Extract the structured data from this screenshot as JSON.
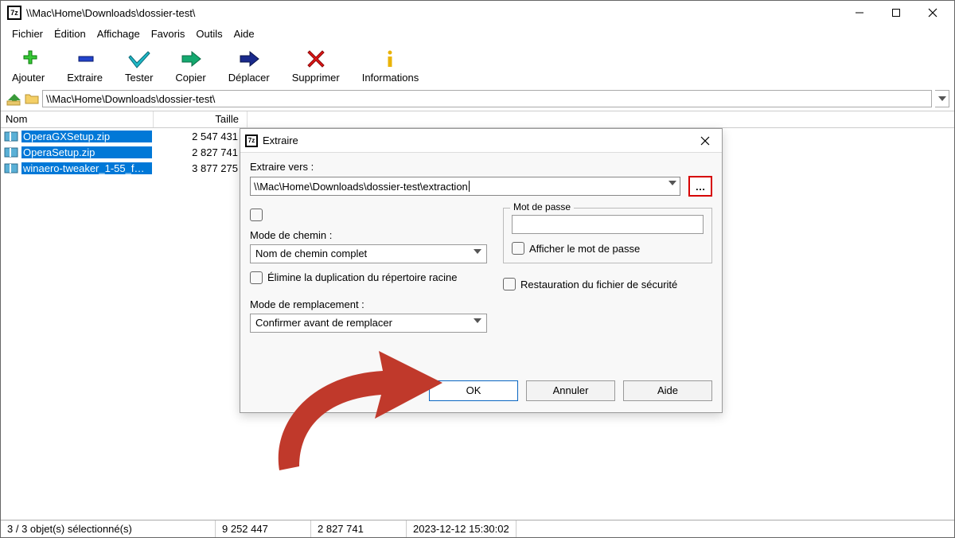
{
  "window": {
    "title": "\\\\Mac\\Home\\Downloads\\dossier-test\\",
    "app_glyph": "7z"
  },
  "menu": {
    "file": "Fichier",
    "edit": "Édition",
    "view": "Affichage",
    "favorites": "Favoris",
    "tools": "Outils",
    "help": "Aide"
  },
  "toolbar": {
    "add": "Ajouter",
    "extract": "Extraire",
    "test": "Tester",
    "copy": "Copier",
    "move": "Déplacer",
    "delete": "Supprimer",
    "info": "Informations"
  },
  "addressbar": {
    "path": "\\\\Mac\\Home\\Downloads\\dossier-test\\"
  },
  "columns": {
    "name": "Nom",
    "size": "Taille"
  },
  "files": [
    {
      "name": "OperaGXSetup.zip",
      "size": "2 547 431"
    },
    {
      "name": "OperaSetup.zip",
      "size": "2 827 741"
    },
    {
      "name": "winaero-tweaker_1-55_f…",
      "size": "3 877 275"
    }
  ],
  "statusbar": {
    "selection": "3 / 3 objet(s) sélectionné(s)",
    "total_size": "9 252 447",
    "sel_size": "2 827 741",
    "date": "2023-12-12 15:30:02"
  },
  "dialog": {
    "title": "Extraire",
    "extract_to_label": "Extraire vers :",
    "extract_to_value": "\\\\Mac\\Home\\Downloads\\dossier-test\\extraction",
    "browse_btn": "…",
    "path_mode_label": "Mode de chemin :",
    "path_mode_value": "Nom de chemin complet",
    "eliminate_dup": "Élimine la duplication du répertoire racine",
    "overwrite_label": "Mode de remplacement :",
    "overwrite_value": "Confirmer avant de remplacer",
    "password_group": "Mot de passe",
    "show_password": "Afficher le mot de passe",
    "restore_security": "Restauration du fichier de sécurité",
    "ok": "OK",
    "cancel": "Annuler",
    "help": "Aide"
  }
}
